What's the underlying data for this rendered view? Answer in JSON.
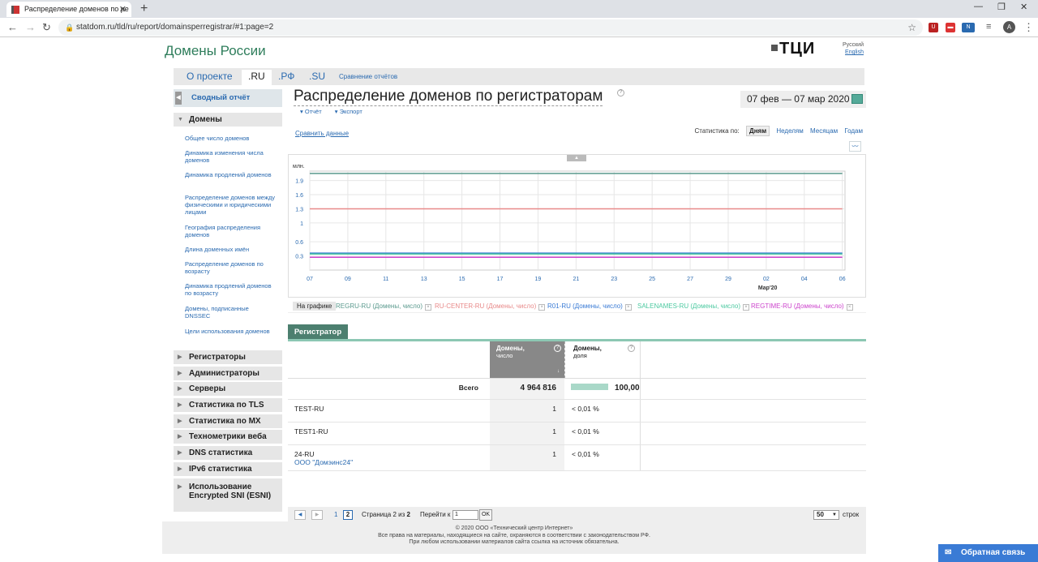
{
  "browser": {
    "tab_title": "Распределение доменов по ре",
    "url": "statdom.ru/tld/ru/report/domainsperregistrar/#1:page=2",
    "profile_initial": "A"
  },
  "header": {
    "site_title": "Домены России",
    "brand": "ТЦИ",
    "lang_ru": "Русский",
    "lang_en": "English"
  },
  "tabs": [
    {
      "label": "О проекте"
    },
    {
      "label": ".RU"
    },
    {
      "label": ".РФ"
    },
    {
      "label": ".SU"
    },
    {
      "label": "Сравнение отчётов"
    }
  ],
  "sidebar": {
    "summary": "Сводный отчёт",
    "domains_title": "Домены",
    "links": [
      "Общее число доменов",
      "Динамика изменения числа доменов",
      "Динамика продлений доменов",
      "Распределение доменов между физическими и юридическими лицами",
      "География распределения доменов",
      "Длина доменных имён",
      "Распределение доменов по возрасту",
      "Динамика продлений доменов по возрасту",
      "Домены, подписанные DNSSEC",
      "Цели использования доменов"
    ],
    "sections": [
      "Регистраторы",
      "Администраторы",
      "Серверы",
      "Статистика по TLS",
      "Статистика по MX",
      "Технометрики веба",
      "DNS статистика",
      "IPv6 статистика",
      "Использование Encrypted SNI (ESNI)"
    ]
  },
  "page": {
    "title": "Распределение доменов по регистраторам",
    "date_range": "07 фев — 07 мар 2020",
    "report_link": "Отчёт",
    "export_link": "Экспорт",
    "compare_link": "Сравнить данные",
    "stats_by": "Статистика по:",
    "stats_options": [
      "Дням",
      "Неделям",
      "Месяцам",
      "Годам"
    ],
    "on_chart_btn": "На графике"
  },
  "chart_data": {
    "type": "line",
    "ylabel": "млн.",
    "yticks": [
      "1.9",
      "1.6",
      "1.3",
      "1",
      "0.6",
      "0.3"
    ],
    "ylim": [
      0,
      2.1
    ],
    "x": [
      "07",
      "09",
      "11",
      "13",
      "15",
      "17",
      "19",
      "21",
      "23",
      "25",
      "27",
      "29",
      "02",
      "04",
      "06"
    ],
    "x_month_label": "Мар'20",
    "series": [
      {
        "name": "REGRU-RU (Домены, число)",
        "color": "#5b9a8e",
        "values": [
          2.05,
          2.05,
          2.05,
          2.05,
          2.05,
          2.05,
          2.05,
          2.05,
          2.05,
          2.05,
          2.05,
          2.05,
          2.05,
          2.05,
          2.05
        ]
      },
      {
        "name": "RU-CENTER-RU (Домены, число)",
        "color": "#e88a8a",
        "values": [
          1.3,
          1.3,
          1.3,
          1.3,
          1.3,
          1.3,
          1.3,
          1.3,
          1.3,
          1.3,
          1.3,
          1.3,
          1.3,
          1.3,
          1.3
        ]
      },
      {
        "name": "R01-RU (Домены, число)",
        "color": "#3a7bd5",
        "values": [
          0.36,
          0.36,
          0.36,
          0.36,
          0.36,
          0.36,
          0.36,
          0.36,
          0.36,
          0.36,
          0.36,
          0.36,
          0.36,
          0.36,
          0.36
        ]
      },
      {
        "name": "SALENAMES-RU (Домены, число)",
        "color": "#4cc9a0",
        "values": [
          0.34,
          0.34,
          0.34,
          0.34,
          0.34,
          0.34,
          0.34,
          0.34,
          0.34,
          0.34,
          0.34,
          0.34,
          0.34,
          0.34,
          0.34
        ]
      },
      {
        "name": "REGTIME-RU (Домены, число)",
        "color": "#cc44cc",
        "values": [
          0.27,
          0.27,
          0.27,
          0.27,
          0.27,
          0.27,
          0.27,
          0.27,
          0.27,
          0.27,
          0.27,
          0.27,
          0.27,
          0.27,
          0.27
        ]
      }
    ]
  },
  "table": {
    "tab_label": "Регистратор",
    "col_sum_title": "Домены,",
    "col_sum_sub": "число",
    "col_share_title": "Домены,",
    "col_share_sub": "доля",
    "total_label": "Всего",
    "total_sum": "4 964 816",
    "total_share": "100,00",
    "total_share_fraction": 1.0,
    "rows": [
      {
        "name": "TEST-RU",
        "sub": "",
        "sum": "1",
        "share": "< 0,01 %"
      },
      {
        "name": "TEST1-RU",
        "sub": "",
        "sum": "1",
        "share": "< 0,01 %"
      },
      {
        "name": "24-RU",
        "sub": "ООО \"Домэинс24\"",
        "sum": "1",
        "share": "< 0,01 %"
      }
    ]
  },
  "pager": {
    "page1": "1",
    "page2": "2",
    "page_info_prefix": "Страница 2 из",
    "page_total": "2",
    "goto_label": "Перейти к",
    "goto_value": "1",
    "ok": "OK",
    "rows_value": "50",
    "rows_label": "строк"
  },
  "footer": {
    "line1": "© 2020 ООО «Технический центр Интернет»",
    "line2": "Все права на материалы, находящиеся на сайте, охраняются в соответствии с законодательством РФ.",
    "line3": "При любом использовании материалов сайта ссылка на источник обязательна."
  },
  "feedback": "Обратная связь"
}
